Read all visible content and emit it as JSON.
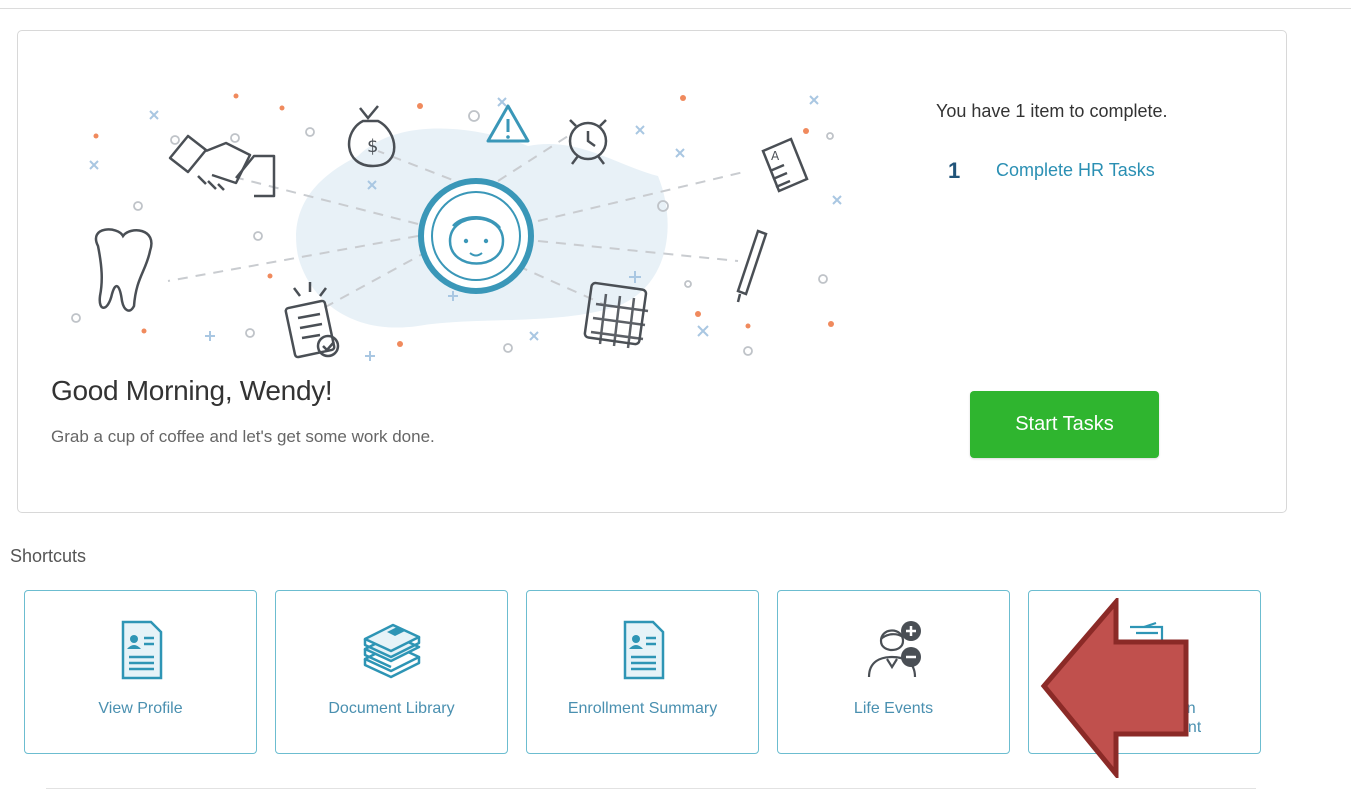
{
  "hero": {
    "greeting": "Good Morning, Wendy!",
    "subtext": "Grab a cup of coffee and let's get some work done.",
    "summary": "You have 1 item to complete.",
    "task_count": "1",
    "task_label": "Complete HR Tasks",
    "start_button": "Start Tasks",
    "illustration_icons": [
      "handshake-icon",
      "tooth-icon",
      "money-bag-icon",
      "alert-icon",
      "alarm-clock-icon",
      "document-icon",
      "pen-icon",
      "calendar-icon",
      "checklist-icon",
      "user-face-icon"
    ]
  },
  "shortcuts": {
    "title": "Shortcuts",
    "items": [
      {
        "label": "View Profile",
        "icon": "profile-card-icon"
      },
      {
        "label": "Document Library",
        "icon": "book-stack-icon"
      },
      {
        "label": "Enrollment Summary",
        "icon": "summary-card-icon"
      },
      {
        "label": "Life Events",
        "icon": "life-events-icon"
      },
      {
        "label": "ation",
        "label_line2": "tatement",
        "icon": "statement-icon"
      }
    ]
  },
  "colors": {
    "accent": "#2a8fb3",
    "start_button": "#2fb52f",
    "task_count": "#21547a",
    "shortcut_border": "#6cbdd0",
    "overlay_arrow": "#c0504d"
  }
}
